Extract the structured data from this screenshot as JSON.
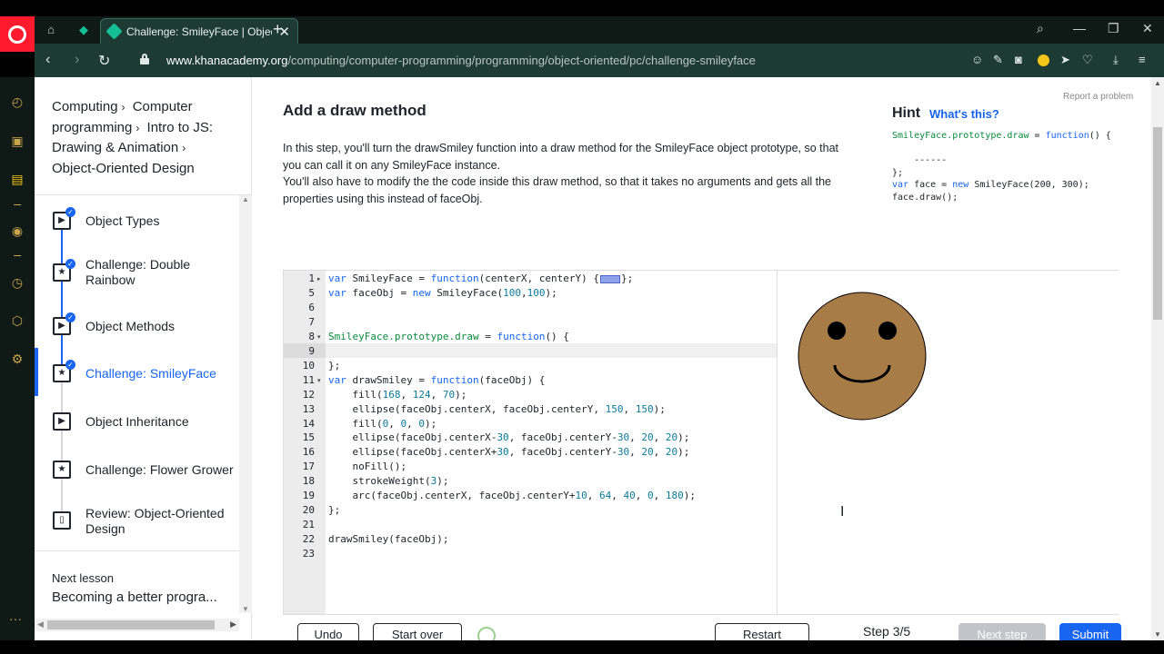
{
  "browser": {
    "tab_title": "Challenge: SmileyFace | Object-Oriented Design",
    "url_host": "www.khanacademy.org",
    "url_path": "/computing/computer-programming/programming/object-oriented/pc/challenge-smileyface",
    "new_tab": "+",
    "close_tab": "✕"
  },
  "sidebar_icons": [
    "speed-dial-icon",
    "work-icon",
    "twitch-icon",
    "player-icon",
    "history-icon",
    "extensions-icon",
    "settings-icon",
    "more-icon"
  ],
  "breadcrumb": {
    "items": [
      "Computing",
      "Computer programming",
      "Intro to JS: Drawing & Animation",
      "Object-Oriented Design"
    ],
    "sep": "›"
  },
  "lessons": [
    {
      "title": "Object Types",
      "type": "video",
      "done": true,
      "icon": "▶"
    },
    {
      "title": "Challenge: Double Rainbow",
      "type": "challenge",
      "done": true,
      "icon": "★"
    },
    {
      "title": "Object Methods",
      "type": "video",
      "done": true,
      "icon": "▶"
    },
    {
      "title": "Challenge: SmileyFace",
      "type": "challenge",
      "done": true,
      "icon": "★",
      "active": true
    },
    {
      "title": "Object Inheritance",
      "type": "video",
      "done": false,
      "icon": "▶"
    },
    {
      "title": "Challenge: Flower Grower",
      "type": "challenge",
      "done": false,
      "icon": "★"
    },
    {
      "title": "Review: Object-Oriented Design",
      "type": "article",
      "done": false,
      "icon": "▯"
    }
  ],
  "check_mark": "✓",
  "next_lesson": {
    "label": "Next lesson",
    "title": "Becoming a better progra..."
  },
  "main": {
    "step_title": "Add a draw method",
    "desc_lines": [
      "In this step, you'll turn the drawSmiley function into a draw method for the SmileyFace object prototype, so that",
      "you can call it on any SmileyFace instance.",
      "You'll also have to modify the the code inside this draw method, so that it takes no arguments and gets all the",
      "properties using this instead of faceObj."
    ],
    "report": "Report a problem"
  },
  "hint": {
    "title": "Hint",
    "link": "What's this?",
    "lines": [
      "SmileyFace.prototype.draw = function() {",
      "",
      "    ------",
      "};",
      "var face = new SmileyFace(200, 300);",
      "face.draw();"
    ]
  },
  "editor": {
    "line_numbers": [
      "1",
      "5",
      "6",
      "7",
      "8",
      "9",
      "10",
      "11",
      "12",
      "13",
      "14",
      "15",
      "16",
      "17",
      "18",
      "19",
      "20",
      "21",
      "22",
      "23"
    ],
    "lines": [
      "var SmileyFace = function(centerX, centerY) {▭};",
      "var faceObj = new SmileyFace(100,100);",
      "",
      "",
      "SmileyFace.prototype.draw = function() {",
      "",
      "};",
      "var drawSmiley = function(faceObj) {",
      "    fill(168, 124, 70);",
      "    ellipse(faceObj.centerX, faceObj.centerY, 150, 150);",
      "    fill(0, 0, 0);",
      "    ellipse(faceObj.centerX-30, faceObj.centerY-30, 20, 20);",
      "    ellipse(faceObj.centerX+30, faceObj.centerY-30, 20, 20);",
      "    noFill();",
      "    strokeWeight(3);",
      "    arc(faceObj.centerX, faceObj.centerY+10, 64, 40, 0, 180);",
      "};",
      "",
      "drawSmiley(faceObj);",
      ""
    ],
    "face_color": "#a87c46"
  },
  "toolbar": {
    "undo": "Undo",
    "start_over": "Start over",
    "restart": "Restart",
    "step": "Step 3/5",
    "next_step": "Next step",
    "submit": "Submit"
  },
  "colors": {
    "accent": "#1865f2",
    "chrome": "#1d3b33",
    "opera_red": "#ff1b2d"
  }
}
